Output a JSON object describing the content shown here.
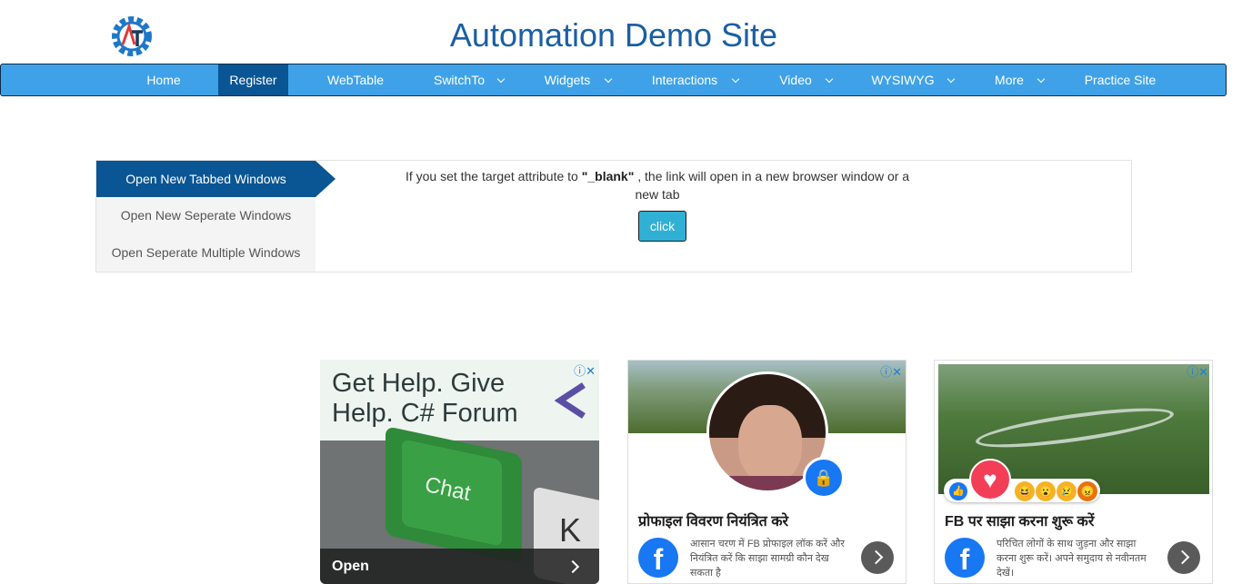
{
  "header": {
    "title": "Automation Demo Site",
    "logo_text": "AT"
  },
  "nav": {
    "items": [
      {
        "label": "Home",
        "dropdown": false
      },
      {
        "label": "Register",
        "dropdown": false,
        "active": true
      },
      {
        "label": "WebTable",
        "dropdown": false
      },
      {
        "label": "SwitchTo",
        "dropdown": true
      },
      {
        "label": "Widgets",
        "dropdown": true
      },
      {
        "label": "Interactions",
        "dropdown": true
      },
      {
        "label": "Video",
        "dropdown": true
      },
      {
        "label": "WYSIWYG",
        "dropdown": true
      },
      {
        "label": "More",
        "dropdown": true
      },
      {
        "label": "Practice Site",
        "dropdown": false
      }
    ]
  },
  "windows": {
    "tabs": [
      {
        "label": "Open New Tabbed Windows",
        "active": true
      },
      {
        "label": "Open New Seperate Windows"
      },
      {
        "label": "Open Seperate Multiple Windows"
      }
    ],
    "desc_pre": "If you set the target attribute to ",
    "desc_bold": "\"_blank\"",
    "desc_post": " , the link will open in a new browser window or a new tab",
    "button_label": "click"
  },
  "ads": {
    "ad1": {
      "headline": "Get Help. Give Help. C# Forum",
      "key_text": "Chat",
      "key_letter": "K",
      "cta": "Open"
    },
    "ad2": {
      "headline": "प्रोफाइल विवरण नियंत्रित करे",
      "body": "आसान चरण में FB प्रोफाइल लॉक करें और नियंत्रित करें कि साझा सामग्री कौन देख सकता है"
    },
    "ad3": {
      "headline": "FB पर साझा करना शुरू करें",
      "body": "परिचित लोगों के साथ जुड़ना और साझा करना शुरू करें। अपने समुदाय से नवीनतम देखें।"
    },
    "fb_logo": "f",
    "ad_choices_icon": "ⓘ✕"
  },
  "colors": {
    "title": "#1a5fa3",
    "nav_bg": "#3fa2e8",
    "nav_active": "#0a5593",
    "button": "#31b0d5"
  }
}
